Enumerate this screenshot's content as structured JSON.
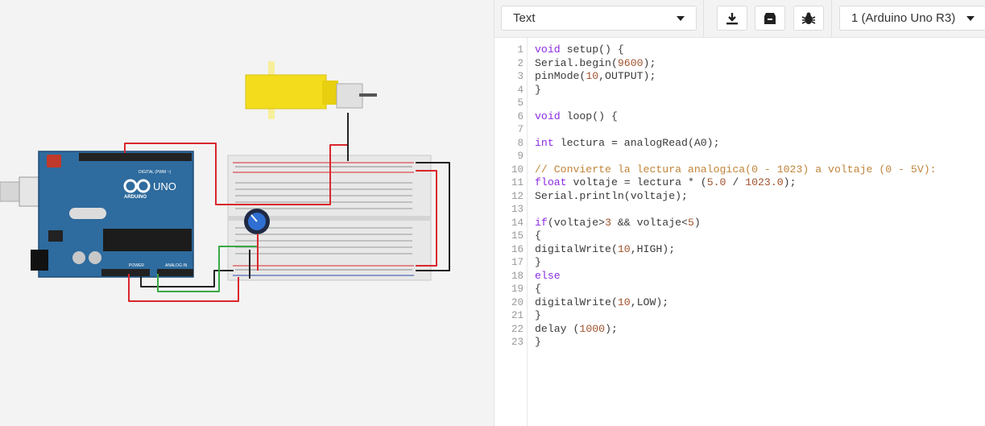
{
  "toolbar": {
    "mode_label": "Text",
    "board_label": "1 (Arduino Uno R3)",
    "download_icon": "download-icon",
    "library_icon": "library-icon",
    "debug_icon": "bug-icon"
  },
  "arduino": {
    "logo_text": "UNO",
    "brand_text": "ARDUINO",
    "digital_label": "DIGITAL (PWM ~)",
    "power_label": "POWER",
    "analog_label": "ANALOG IN"
  },
  "code": {
    "lines": [
      {
        "n": "1",
        "t": "void setup() {"
      },
      {
        "n": "2",
        "t": "Serial.begin(9600);"
      },
      {
        "n": "3",
        "t": "pinMode(10,OUTPUT);"
      },
      {
        "n": "4",
        "t": "}"
      },
      {
        "n": "5",
        "t": ""
      },
      {
        "n": "6",
        "t": "void loop() {"
      },
      {
        "n": "7",
        "t": ""
      },
      {
        "n": "8",
        "t": "int lectura = analogRead(A0);"
      },
      {
        "n": "9",
        "t": ""
      },
      {
        "n": "10",
        "t": "// Convierte la lectura analogica(0 - 1023) a voltaje (0 - 5V):"
      },
      {
        "n": "11",
        "t": "float voltaje = lectura * (5.0 / 1023.0);"
      },
      {
        "n": "12",
        "t": "Serial.println(voltaje);"
      },
      {
        "n": "13",
        "t": ""
      },
      {
        "n": "14",
        "t": "if(voltaje>3 && voltaje<5)"
      },
      {
        "n": "15",
        "t": "{"
      },
      {
        "n": "16",
        "t": "digitalWrite(10,HIGH);"
      },
      {
        "n": "17",
        "t": "}"
      },
      {
        "n": "18",
        "t": "else"
      },
      {
        "n": "19",
        "t": "{"
      },
      {
        "n": "20",
        "t": "digitalWrite(10,LOW);"
      },
      {
        "n": "21",
        "t": "}"
      },
      {
        "n": "22",
        "t": "delay (1000);"
      },
      {
        "n": "23",
        "t": "}"
      }
    ]
  },
  "colors": {
    "arduino_board": "#2e6b9e",
    "wire_red": "#d9262c",
    "wire_black": "#222222",
    "wire_green": "#3aa845",
    "motor_yellow": "#f2dc1c"
  }
}
